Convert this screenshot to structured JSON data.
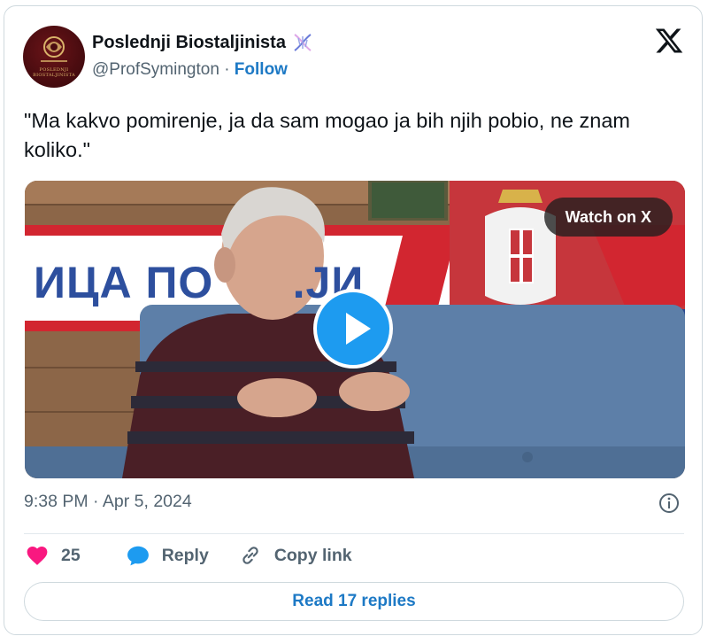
{
  "author": {
    "name": "Poslednji Biostaljinista",
    "name_icon": "dna-icon",
    "handle": "@ProfSymington",
    "separator": "·",
    "follow_label": "Follow",
    "avatar_text": "POSLEDNJI BIOSTALJINISTA"
  },
  "platform_icon": "x-logo-icon",
  "tweet": {
    "text": "\"Ma kakvo pomirenje, ja da sam mogao ja bih njih pobio, ne znam koliko.\""
  },
  "media": {
    "watch_label": "Watch on X",
    "banner_text": "ИЦА ПО      .ЈИ",
    "play_icon": "play-icon"
  },
  "meta": {
    "timestamp": "9:38 PM · Apr 5, 2024",
    "info_icon": "info-icon"
  },
  "actions": {
    "likes": "25",
    "reply_label": "Reply",
    "copy_label": "Copy link"
  },
  "footer": {
    "read_replies_label": "Read 17 replies"
  },
  "colors": {
    "accent": "#1d79c5",
    "like": "#f91880",
    "reply_icon": "#1d9bf0",
    "muted": "#536471"
  }
}
